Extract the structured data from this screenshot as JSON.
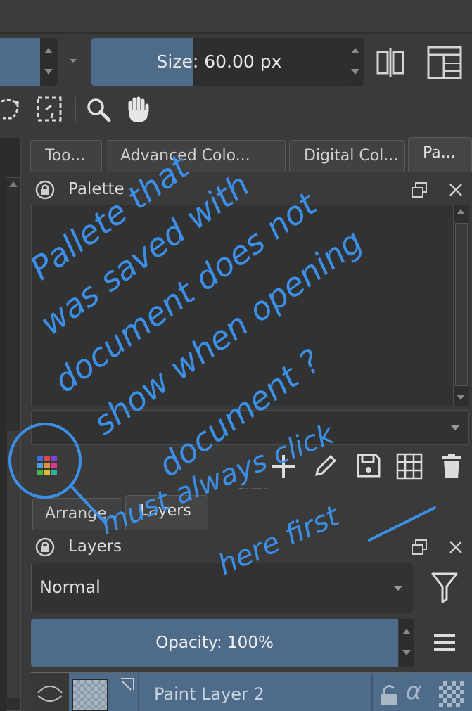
{
  "toolbar": {
    "size_label": "Size:",
    "size_value": "60.00 px"
  },
  "tools": {
    "icons": [
      "freehand-selection-icon",
      "similar-selection-icon",
      "zoom-icon",
      "pan-icon"
    ]
  },
  "docker_tabs": [
    {
      "label": "Too..."
    },
    {
      "label": "Advanced Colo..."
    },
    {
      "label": "Digital Col..."
    },
    {
      "label": "Pa..."
    }
  ],
  "palette": {
    "title": "Palette",
    "actions": [
      "add-swatch-icon",
      "edit-swatch-icon",
      "save-palette-icon",
      "palette-grid-icon",
      "delete-swatch-icon"
    ]
  },
  "lower_tabs": [
    {
      "label": "Arrange"
    },
    {
      "label": "Layers"
    }
  ],
  "layers": {
    "title": "Layers",
    "blend_mode": "Normal",
    "opacity_label": "Opacity:",
    "opacity_value": "100%",
    "layer_name": "Paint Layer 2",
    "alpha_symbol": "α"
  },
  "annotation": {
    "color": "#3b8fe6",
    "lines": [
      "Pallete that",
      "was saved with",
      "document does not",
      "show when opening",
      "document ?",
      "must always click",
      "here first"
    ]
  },
  "colors": {
    "accent": "#4f6b8a",
    "background": "#3a3a3a",
    "panel": "#313131"
  }
}
